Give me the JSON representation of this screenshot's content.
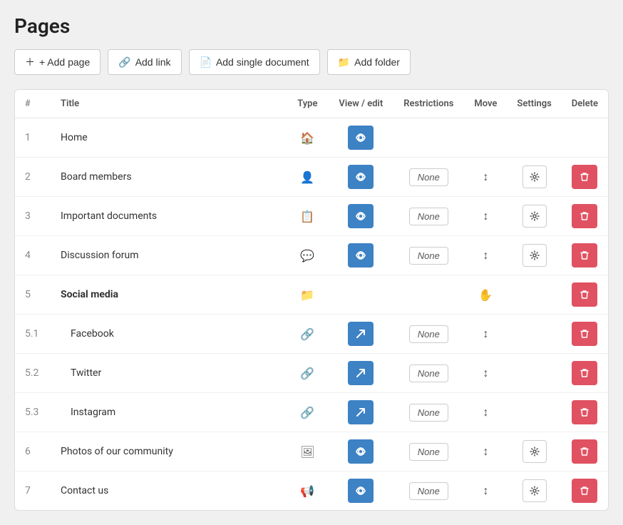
{
  "page": {
    "title": "Pages"
  },
  "toolbar": {
    "add_page": "+ Add page",
    "add_link": "Add link",
    "add_single_document": "Add single document",
    "add_folder": "Add folder"
  },
  "table": {
    "headers": {
      "num": "#",
      "title": "Title",
      "type": "Type",
      "view_edit": "View / edit",
      "restrictions": "Restrictions",
      "move": "Move",
      "settings": "Settings",
      "delete": "Delete"
    },
    "rows": [
      {
        "num": "1",
        "title": "Home",
        "type_icon": "🏠",
        "has_view": true,
        "view_icon": "🔍",
        "has_restrict": false,
        "has_move": false,
        "has_settings": false,
        "has_delete": false,
        "bold": false,
        "is_link": false
      },
      {
        "num": "2",
        "title": "Board members",
        "type_icon": "👤",
        "has_view": true,
        "view_icon": "🔍",
        "has_restrict": true,
        "restrict_val": "None",
        "has_move": true,
        "has_settings": true,
        "has_delete": true,
        "bold": false,
        "is_link": false
      },
      {
        "num": "3",
        "title": "Important documents",
        "type_icon": "📋",
        "has_view": true,
        "view_icon": "🔍",
        "has_restrict": true,
        "restrict_val": "None",
        "has_move": true,
        "has_settings": true,
        "has_delete": true,
        "bold": false,
        "is_link": false
      },
      {
        "num": "4",
        "title": "Discussion forum",
        "type_icon": "💬",
        "has_view": true,
        "view_icon": "🔍",
        "has_restrict": true,
        "restrict_val": "None",
        "has_move": true,
        "has_settings": true,
        "has_delete": true,
        "bold": false,
        "is_link": false
      },
      {
        "num": "5",
        "title": "Social media",
        "type_icon": "📁",
        "has_view": false,
        "has_restrict": false,
        "has_move": true,
        "move_special": true,
        "has_settings": false,
        "has_delete": true,
        "bold": true,
        "is_link": false
      },
      {
        "num": "5.1",
        "title": "Facebook",
        "type_icon": "🔗",
        "has_view": true,
        "view_icon": "↗",
        "has_restrict": true,
        "restrict_val": "None",
        "has_move": true,
        "has_settings": false,
        "has_delete": true,
        "bold": false,
        "is_link": true,
        "indent": true
      },
      {
        "num": "5.2",
        "title": "Twitter",
        "type_icon": "🔗",
        "has_view": true,
        "view_icon": "↗",
        "has_restrict": true,
        "restrict_val": "None",
        "has_move": true,
        "has_settings": false,
        "has_delete": true,
        "bold": false,
        "is_link": true,
        "indent": true
      },
      {
        "num": "5.3",
        "title": "Instagram",
        "type_icon": "🔗",
        "has_view": true,
        "view_icon": "↗",
        "has_restrict": true,
        "restrict_val": "None",
        "has_move": true,
        "has_settings": false,
        "has_delete": true,
        "bold": false,
        "is_link": true,
        "indent": true
      },
      {
        "num": "6",
        "title": "Photos of our community",
        "type_icon": "🖼",
        "has_view": true,
        "view_icon": "🔍",
        "has_restrict": true,
        "restrict_val": "None",
        "has_move": true,
        "has_settings": true,
        "has_delete": true,
        "bold": false,
        "is_link": false
      },
      {
        "num": "7",
        "title": "Contact us",
        "type_icon": "📢",
        "has_view": true,
        "view_icon": "🔍",
        "has_restrict": true,
        "restrict_val": "None",
        "has_move": true,
        "has_settings": true,
        "has_delete": true,
        "bold": false,
        "is_link": false
      }
    ]
  }
}
